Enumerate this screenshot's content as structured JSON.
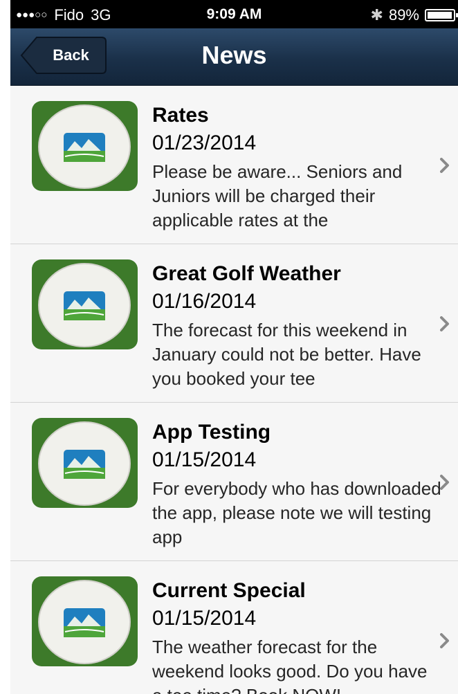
{
  "status_bar": {
    "signal": "●●●○○",
    "carrier": "Fido",
    "network": "3G",
    "time": "9:09 AM",
    "bluetooth_icon": "bluetooth-icon",
    "battery": "89%"
  },
  "nav": {
    "back_label": "Back",
    "title": "News"
  },
  "news": [
    {
      "title": "Rates",
      "date": "01/23/2014",
      "snippet": "Please be aware... Seniors and Juniors will be charged their applicable rates at the"
    },
    {
      "title": "Great Golf Weather",
      "date": "01/16/2014",
      "snippet": "The forecast for this weekend in January could not be better. Have you booked your tee"
    },
    {
      "title": "App Testing",
      "date": "01/15/2014",
      "snippet": "For everybody who has downloaded the app, please note we will testing app"
    },
    {
      "title": "Current Special",
      "date": "01/15/2014",
      "snippet": "The weather forecast for the weekend looks good. Do you have a tee time? Book NOW!"
    }
  ],
  "colors": {
    "nav_bar": "#1a3049",
    "status_bar": "#000000",
    "list_background": "#f6f6f6",
    "chevron": "#8a8a8a",
    "thumbnail_grass": "#3d7a2a"
  }
}
